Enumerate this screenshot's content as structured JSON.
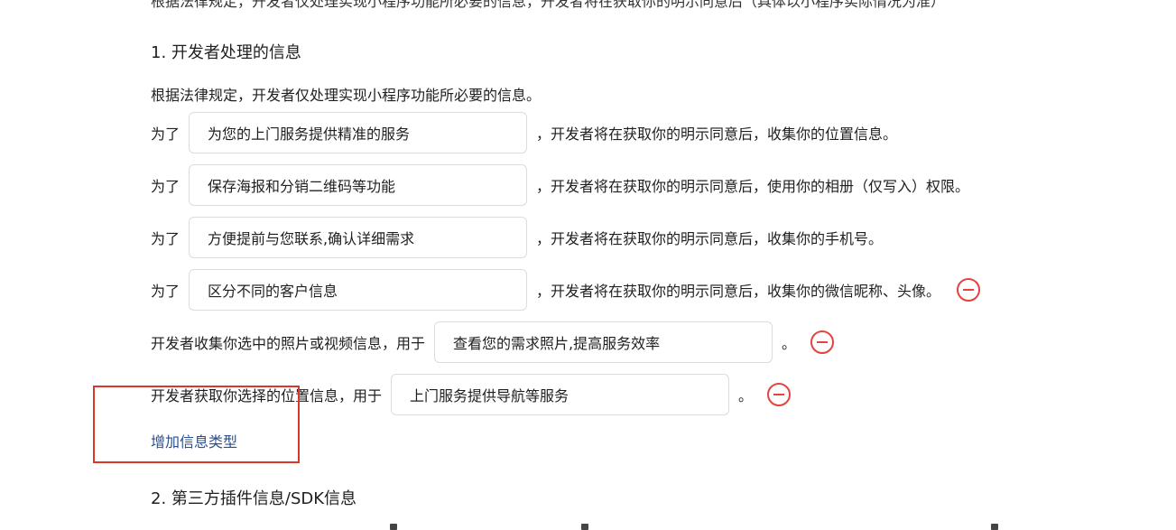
{
  "header_cutoff": "根据法律规定，开发者仅处理实现小程序功能所必要的信息，开发者将在获取你的明示同意后（具体以小程序实际情况为准）",
  "section1": {
    "title": "1.  开发者处理的信息",
    "intro": "根据法律规定，开发者仅处理实现小程序功能所必要的信息。"
  },
  "rows": [
    {
      "prefix": "为了",
      "value": "为您的上门服务提供精准的服务",
      "suffix": "，开发者将在获取你的明示同意后，收集你的位置信息。"
    },
    {
      "prefix": "为了",
      "value": "保存海报和分销二维码等功能",
      "suffix": "，开发者将在获取你的明示同意后，使用你的相册（仅写入）权限。"
    },
    {
      "prefix": "为了",
      "value": "方便提前与您联系,确认详细需求",
      "suffix": "，开发者将在获取你的明示同意后，收集你的手机号。"
    },
    {
      "prefix": "为了",
      "value": "区分不同的客户信息",
      "suffix": "，开发者将在获取你的明示同意后，收集你的微信昵称、头像。"
    }
  ],
  "photo_row": {
    "prefix": "开发者收集你选中的照片或视频信息，用于",
    "value": "查看您的需求照片,提高服务效率",
    "suffix": "。"
  },
  "location_row": {
    "prefix": "开发者获取你选择的位置信息，用于",
    "value": "上门服务提供导航等服务",
    "suffix": "。"
  },
  "add_link": "增加信息类型",
  "section2": {
    "title": "2.  第三方插件信息/SDK信息"
  },
  "colors": {
    "remove_icon": "#e64340",
    "link": "#2a4f8e",
    "highlight_box": "#d9362c"
  }
}
